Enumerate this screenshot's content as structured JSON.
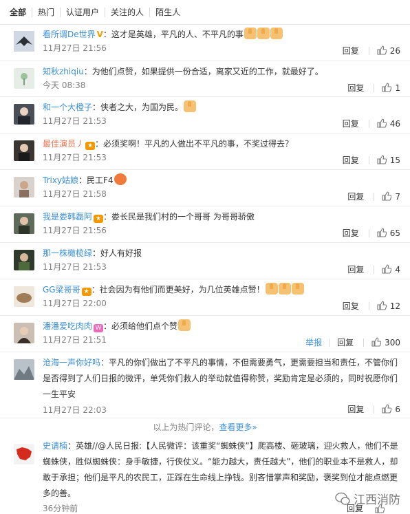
{
  "tabs": [
    "全部",
    "热门",
    "认证用户",
    "关注的人",
    "陌生人"
  ],
  "actions": {
    "reply": "回复",
    "report": "举报"
  },
  "comments": [
    {
      "user": "看所谓De世界",
      "text": "：这才是英雄，平凡的人、不平凡的事",
      "time": "11月27日 21:56",
      "likes": "26"
    },
    {
      "user": "知秋zhiqiu",
      "text": "：为他们点赞，如果提供一份合适，离家又近的工作，就最好了。",
      "time": "今天 08:38",
      "likes": "1"
    },
    {
      "user": "和一个大橙子",
      "text": "：侠者之大，为国为民。",
      "time": "11月27日 21:53",
      "likes": "46"
    },
    {
      "user": "最佳演员丿",
      "text": "：必须奖啊！平凡的人做出不平凡的事，不奖过得去？",
      "time": "11月27日 21:53",
      "likes": "15"
    },
    {
      "user": "Trixy姑娘",
      "text": "：民工F4",
      "time": "11月27日 21:58",
      "likes": "7"
    },
    {
      "user": "我是娄韩磊阿",
      "text": "：娄长民是我们村的一个哥哥 为哥哥骄傲",
      "time": "11月27日 21:56",
      "likes": "65"
    },
    {
      "user": "那一株橄榄绿",
      "text": "：好人有好报",
      "time": "11月27日 21:53",
      "likes": "4"
    },
    {
      "user": "GG梁哥哥",
      "text": "：社会因为有他们而更美好，为几位英雄点赞！",
      "time": "11月27日 22:00",
      "likes": "12"
    },
    {
      "user": "潘潘爱吃肉肉",
      "text": "：必须给他们点个赞",
      "time": "11月27日 21:51",
      "likes": "300"
    },
    {
      "user": "沧海一声你好吗",
      "text": "：平凡的你们做出了不平凡的事情，不但需要勇气，更需要担当和责任，不管你们是否得到了人们日报的微评，单凭你们救人的举动就值得称赞，奖励肯定是必须的，同时祝愿你们一生平安",
      "time": "11月27日 22:03",
      "likes": "6"
    }
  ],
  "footer": {
    "note": "以上为热门评论，",
    "more": "查看更多»"
  },
  "repost": {
    "user": "史请楠",
    "mention": "：英雄//@人民日报:",
    "text": "【人民微评：该重奖“蜘蛛侠”】爬高楼、砸玻璃，迎火救人，他们不是蜘蛛侠，胜似蜘蛛侠：身手敏捷，行侠仗义。“能力越大，责任越大”，他们的职业本不是救人，却敢于承担；他们是平凡的农民工，正踩在生命线上挣钱。别吝惜掌声和奖励，褒奖到位才能点燃更多的善。",
    "time": "36分钟前",
    "reply": "回复",
    "watermark": "江西消防"
  },
  "colors": {
    "username": "#eb7350",
    "link": "#3b8fd6",
    "muted": "#808080"
  }
}
